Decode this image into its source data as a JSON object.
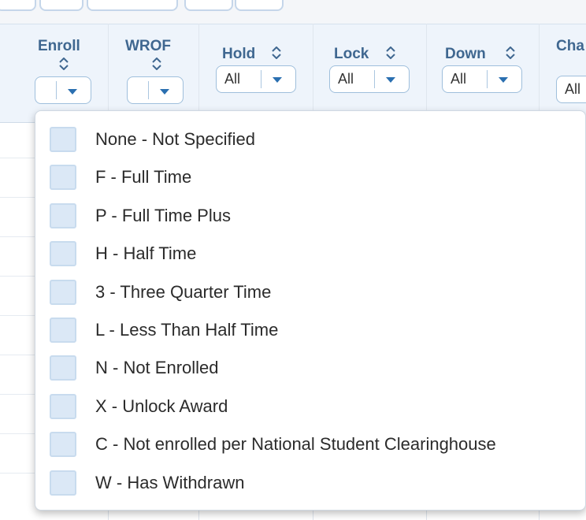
{
  "grid": {
    "columns": [
      {
        "key": "enroll",
        "label": "Enroll",
        "sortable": true,
        "filter_value": ""
      },
      {
        "key": "wrof",
        "label": "WROF",
        "sortable": true,
        "filter_value": ""
      },
      {
        "key": "hold",
        "label": "Hold",
        "sortable": true,
        "filter_value": "All"
      },
      {
        "key": "lock",
        "label": "Lock",
        "sortable": true,
        "filter_value": "All"
      },
      {
        "key": "down",
        "label": "Down",
        "sortable": true,
        "filter_value": "All"
      },
      {
        "key": "cha",
        "label": "Cha",
        "sortable": false,
        "filter_value": "All"
      }
    ]
  },
  "enroll_menu": {
    "options": [
      {
        "label": "None - Not Specified",
        "checked": false
      },
      {
        "label": "F - Full Time",
        "checked": false
      },
      {
        "label": "P - Full Time Plus",
        "checked": false
      },
      {
        "label": "H - Half Time",
        "checked": false
      },
      {
        "label": "3 - Three Quarter Time",
        "checked": false
      },
      {
        "label": "L - Less Than Half Time",
        "checked": false
      },
      {
        "label": "N - Not Enrolled",
        "checked": false
      },
      {
        "label": "X - Unlock Award",
        "checked": false
      },
      {
        "label": "C - Not enrolled per National Student Clearinghouse",
        "checked": false
      },
      {
        "label": "W - Has Withdrawn",
        "checked": false
      }
    ]
  },
  "colors": {
    "header_bg": "#eef4fb",
    "header_text": "#3f6790",
    "caret": "#2a6fb0",
    "checkbox_fill": "#dbe8f6"
  }
}
